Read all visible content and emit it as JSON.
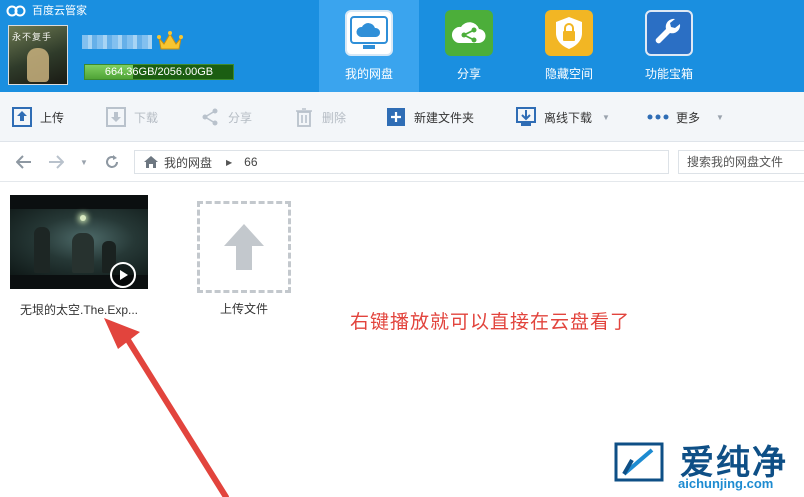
{
  "app": {
    "title": "百度云管家"
  },
  "user": {
    "quota_text": "664.36GB/2056.00GB",
    "quota_used_fraction": 0.323,
    "avatar_text": "永不复手"
  },
  "nav": {
    "items": [
      {
        "label": "我的网盘",
        "icon": "cloud-icon",
        "active": true
      },
      {
        "label": "分享",
        "icon": "share-icon",
        "active": false
      },
      {
        "label": "隐藏空间",
        "icon": "lock-icon",
        "active": false
      },
      {
        "label": "功能宝箱",
        "icon": "wrench-icon",
        "active": false
      }
    ]
  },
  "toolbar": {
    "upload": "上传",
    "download": "下载",
    "share": "分享",
    "delete": "删除",
    "new_folder": "新建文件夹",
    "offline_download": "离线下载",
    "more": "更多"
  },
  "addressbar": {
    "root": "我的网盘",
    "current": "66",
    "search_placeholder": "搜索我的网盘文件"
  },
  "files": [
    {
      "name": "无垠的太空.The.Exp...",
      "type": "video"
    },
    {
      "name": "上传文件",
      "type": "upload-placeholder"
    }
  ],
  "annotation": {
    "text": "右键播放就可以直接在云盘看了",
    "color": "#e2443d"
  },
  "watermark": {
    "title": "爱纯净",
    "url": "aichunjing.com"
  },
  "colors": {
    "header_bg": "#1a8fe0",
    "nav_active": "#3aa4ee",
    "quota_fill": "#4fa336"
  }
}
